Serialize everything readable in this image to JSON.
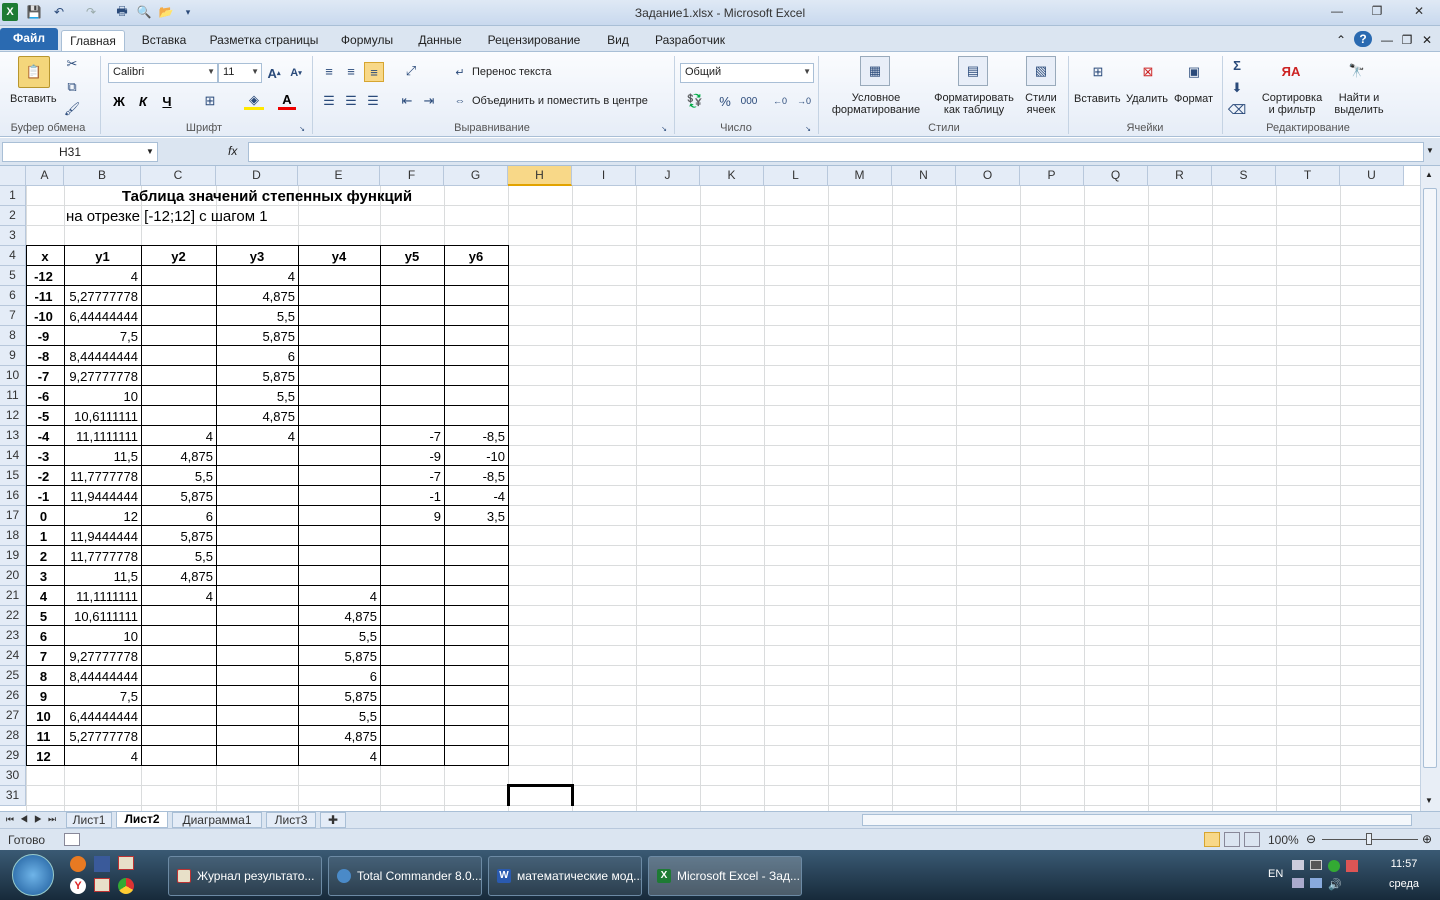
{
  "window": {
    "title": "Задание1.xlsx - Microsoft Excel"
  },
  "ribbon": {
    "tabs": [
      "Файл",
      "Главная",
      "Вставка",
      "Разметка страницы",
      "Формулы",
      "Данные",
      "Рецензирование",
      "Вид",
      "Разработчик"
    ],
    "paste_label": "Вставить",
    "font_name": "Calibri",
    "font_size": "11",
    "wrap_text": "Перенос текста",
    "merge_center": "Объединить и поместить в центре",
    "number_format": "Общий",
    "cond_format": [
      "Условное",
      "форматирование"
    ],
    "format_table": [
      "Форматировать",
      "как таблицу"
    ],
    "cell_styles": [
      "Стили",
      "ячеек"
    ],
    "insert": "Вставить",
    "delete": "Удалить",
    "format": "Формат",
    "sort_filter": [
      "Сортировка",
      "и фильтр"
    ],
    "find_select": [
      "Найти и",
      "выделить"
    ],
    "groups": [
      "Буфер обмена",
      "Шрифт",
      "Выравнивание",
      "Число",
      "Стили",
      "Ячейки",
      "Редактирование"
    ]
  },
  "formula_bar": {
    "name_box": "H31",
    "fx": "fx",
    "value": ""
  },
  "sheet": {
    "columns": [
      "A",
      "B",
      "C",
      "D",
      "E",
      "F",
      "G",
      "H",
      "I",
      "J",
      "K",
      "L",
      "M",
      "N",
      "O",
      "P",
      "Q",
      "R",
      "S",
      "T",
      "U"
    ],
    "selected_column": "H",
    "rows": [
      "1",
      "2",
      "3",
      "4",
      "5",
      "6",
      "7",
      "8",
      "9",
      "10",
      "11",
      "12",
      "13",
      "14",
      "15",
      "16",
      "17",
      "18",
      "19",
      "20",
      "21",
      "22",
      "23",
      "24",
      "25",
      "26",
      "27",
      "28",
      "29",
      "30",
      "31"
    ],
    "title": "Таблица значений степенных функций",
    "subtitle": "на отрезке [-12;12] с шагом 1",
    "table_headers": [
      "x",
      "y1",
      "y2",
      "y3",
      "y4",
      "y5",
      "y6"
    ],
    "table_rows": [
      [
        "-12",
        "4",
        "",
        "4",
        "",
        "",
        ""
      ],
      [
        "-11",
        "5,27777778",
        "",
        "4,875",
        "",
        "",
        ""
      ],
      [
        "-10",
        "6,44444444",
        "",
        "5,5",
        "",
        "",
        ""
      ],
      [
        "-9",
        "7,5",
        "",
        "5,875",
        "",
        "",
        ""
      ],
      [
        "-8",
        "8,44444444",
        "",
        "6",
        "",
        "",
        ""
      ],
      [
        "-7",
        "9,27777778",
        "",
        "5,875",
        "",
        "",
        ""
      ],
      [
        "-6",
        "10",
        "",
        "5,5",
        "",
        "",
        ""
      ],
      [
        "-5",
        "10,6111111",
        "",
        "4,875",
        "",
        "",
        ""
      ],
      [
        "-4",
        "11,1111111",
        "4",
        "4",
        "",
        "-7",
        "-8,5"
      ],
      [
        "-3",
        "11,5",
        "4,875",
        "",
        "",
        "-9",
        "-10"
      ],
      [
        "-2",
        "11,7777778",
        "5,5",
        "",
        "",
        "-7",
        "-8,5"
      ],
      [
        "-1",
        "11,9444444",
        "5,875",
        "",
        "",
        "-1",
        "-4"
      ],
      [
        "0",
        "12",
        "6",
        "",
        "",
        "9",
        "3,5"
      ],
      [
        "1",
        "11,9444444",
        "5,875",
        "",
        "",
        "",
        ""
      ],
      [
        "2",
        "11,7777778",
        "5,5",
        "",
        "",
        "",
        ""
      ],
      [
        "3",
        "11,5",
        "4,875",
        "",
        "",
        "",
        ""
      ],
      [
        "4",
        "11,1111111",
        "4",
        "",
        "4",
        "",
        ""
      ],
      [
        "5",
        "10,6111111",
        "",
        "",
        "4,875",
        "",
        ""
      ],
      [
        "6",
        "10",
        "",
        "",
        "5,5",
        "",
        ""
      ],
      [
        "7",
        "9,27777778",
        "",
        "",
        "5,875",
        "",
        ""
      ],
      [
        "8",
        "8,44444444",
        "",
        "",
        "6",
        "",
        ""
      ],
      [
        "9",
        "7,5",
        "",
        "",
        "5,875",
        "",
        ""
      ],
      [
        "10",
        "6,44444444",
        "",
        "",
        "5,5",
        "",
        ""
      ],
      [
        "11",
        "5,27777778",
        "",
        "",
        "4,875",
        "",
        ""
      ],
      [
        "12",
        "4",
        "",
        "",
        "4",
        "",
        ""
      ]
    ]
  },
  "sheet_tabs": {
    "tabs": [
      "Лист1",
      "Лист2",
      "Диаграмма1",
      "Лист3"
    ],
    "active": "Лист2"
  },
  "status": {
    "ready": "Готово",
    "zoom": "100%"
  },
  "taskbar": {
    "buttons": [
      "Журнал результато...",
      "Total Commander 8.0...",
      "математические мод...",
      "Microsoft Excel - Зад..."
    ],
    "lang": "EN",
    "time": "11:57",
    "day": "среда"
  },
  "colors": {
    "selected_header": "#f8d888",
    "file_tab": "#2a6ab1",
    "excel_green": "#1e7b34"
  }
}
